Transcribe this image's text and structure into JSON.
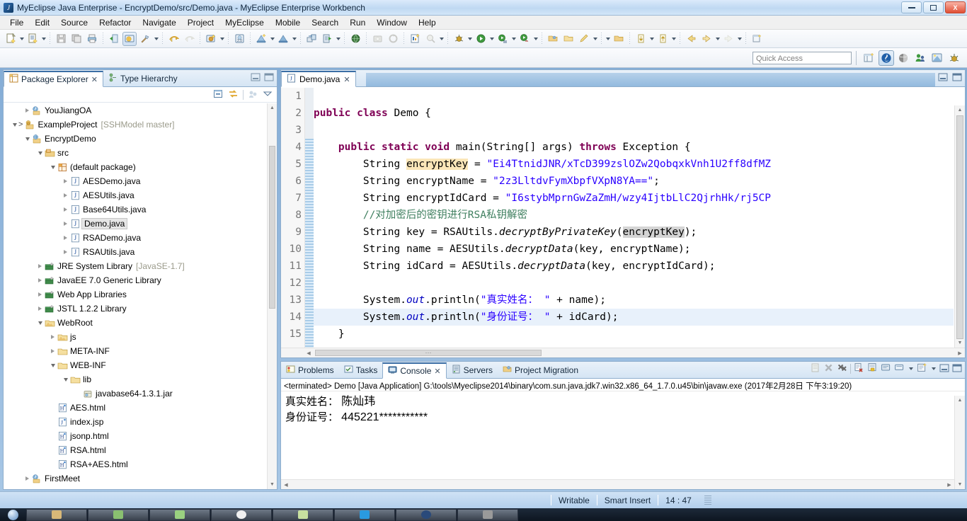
{
  "window": {
    "title": "MyEclipse Java Enterprise - EncryptDemo/src/Demo.java - MyEclipse Enterprise Workbench",
    "logo_glyph": "J",
    "minimize_label": "minimize",
    "restore_label": "restore",
    "close_label": "X"
  },
  "menu": {
    "items": [
      "File",
      "Edit",
      "Source",
      "Refactor",
      "Navigate",
      "Project",
      "MyEclipse",
      "Mobile",
      "Search",
      "Run",
      "Window",
      "Help"
    ]
  },
  "toolbar": {
    "groups": [
      [
        "new-wizard-icon",
        "dropdown",
        "new-java-class-icon",
        "dropdown"
      ],
      [
        "save-icon",
        "save-all-icon",
        "print-icon"
      ],
      [
        "open-browser-icon",
        "web-project-icon",
        "build-hammer-icon",
        "dropdown"
      ],
      [
        "publish-icon",
        "publish-disabled-icon"
      ],
      [
        "deploy-icon",
        "dropdown"
      ],
      [
        "html20-icon"
      ],
      [
        "db-browser-icon",
        "dropdown",
        "db-explorer-icon",
        "dropdown"
      ],
      [
        "remote-sync-icon",
        "run-server-icon",
        "dropdown"
      ],
      [
        "globe-icon"
      ],
      [
        "snapshot-icon",
        "refresh-disabled-icon"
      ],
      [
        "new-report-icon",
        "search-disabled-icon",
        "dropdown"
      ],
      [
        "debug-icon",
        "dropdown"
      ],
      [
        "run-icon",
        "dropdown"
      ],
      [
        "run-config-icon",
        "dropdown"
      ],
      [
        "run-ant-icon",
        "dropdown"
      ],
      [
        "open-type-icon",
        "open-resource-icon",
        "edit-icon",
        "dropdown"
      ],
      [
        "dropdown",
        "folder-icon"
      ],
      [
        "next-annotation-icon",
        "dropdown",
        "prev-annotation-icon",
        "dropdown"
      ],
      [
        "back-icon",
        "forward-icon",
        "dropdown",
        "forward-disabled-icon",
        "dropdown"
      ],
      [
        "new-window-icon"
      ]
    ]
  },
  "quick_access": {
    "placeholder": "Quick Access",
    "value": "",
    "perspective_buttons": [
      "open-perspective-icon",
      "java-perspective-icon",
      "myeclipse-perspective-icon",
      "team-perspective-icon",
      "web-perspective-icon",
      "debug-perspective-icon"
    ]
  },
  "left_view": {
    "tabs": [
      {
        "label": "Package Explorer",
        "icon": "package-explorer-icon",
        "active": true,
        "closable": true
      },
      {
        "label": "Type Hierarchy",
        "icon": "type-hierarchy-icon",
        "active": false,
        "closable": false
      }
    ],
    "tab_controls": [
      "minimize-icon",
      "maximize-icon"
    ],
    "view_toolbar": [
      "collapse-all-icon",
      "link-with-editor-icon",
      "focus-on-active-task-icon",
      "view-menu-icon"
    ],
    "tree": [
      {
        "label": "YouJiangOA",
        "indent": 1,
        "twisty": "collapsed",
        "icon": "java-project-icon",
        "sub": ""
      },
      {
        "label": "ExampleProject",
        "indent": 0,
        "twisty": "expanded",
        "icon": "git-project-icon",
        "sub": "[SSHModel master]",
        "prefix": ">"
      },
      {
        "label": "EncryptDemo",
        "indent": 1,
        "twisty": "expanded",
        "icon": "web-project-icon",
        "sub": ""
      },
      {
        "label": "src",
        "indent": 2,
        "twisty": "expanded",
        "icon": "source-folder-icon",
        "sub": ""
      },
      {
        "label": "(default package)",
        "indent": 3,
        "twisty": "expanded",
        "icon": "package-icon",
        "sub": ""
      },
      {
        "label": "AESDemo.java",
        "indent": 4,
        "twisty": "collapsed",
        "icon": "java-file-icon",
        "sub": ""
      },
      {
        "label": "AESUtils.java",
        "indent": 4,
        "twisty": "collapsed",
        "icon": "java-file-icon",
        "sub": ""
      },
      {
        "label": "Base64Utils.java",
        "indent": 4,
        "twisty": "collapsed",
        "icon": "java-file-icon",
        "sub": ""
      },
      {
        "label": "Demo.java",
        "indent": 4,
        "twisty": "collapsed",
        "icon": "java-file-icon",
        "sub": "",
        "selected": true
      },
      {
        "label": "RSADemo.java",
        "indent": 4,
        "twisty": "collapsed",
        "icon": "java-file-icon",
        "sub": ""
      },
      {
        "label": "RSAUtils.java",
        "indent": 4,
        "twisty": "collapsed",
        "icon": "java-file-icon",
        "sub": ""
      },
      {
        "label": "JRE System Library",
        "indent": 2,
        "twisty": "collapsed",
        "icon": "library-icon",
        "sub": "[JavaSE-1.7]"
      },
      {
        "label": "JavaEE 7.0 Generic Library",
        "indent": 2,
        "twisty": "collapsed",
        "icon": "library-icon",
        "sub": ""
      },
      {
        "label": "Web App Libraries",
        "indent": 2,
        "twisty": "collapsed",
        "icon": "library-icon",
        "sub": ""
      },
      {
        "label": "JSTL 1.2.2 Library",
        "indent": 2,
        "twisty": "collapsed",
        "icon": "library-icon",
        "sub": ""
      },
      {
        "label": "WebRoot",
        "indent": 2,
        "twisty": "expanded",
        "icon": "webroot-folder-icon",
        "sub": ""
      },
      {
        "label": "js",
        "indent": 3,
        "twisty": "collapsed",
        "icon": "webroot-folder-icon",
        "sub": ""
      },
      {
        "label": "META-INF",
        "indent": 3,
        "twisty": "collapsed",
        "icon": "folder-icon",
        "sub": ""
      },
      {
        "label": "WEB-INF",
        "indent": 3,
        "twisty": "expanded",
        "icon": "folder-icon",
        "sub": ""
      },
      {
        "label": "lib",
        "indent": 4,
        "twisty": "expanded",
        "icon": "folder-icon",
        "sub": ""
      },
      {
        "label": "javabase64-1.3.1.jar",
        "indent": 5,
        "twisty": "none",
        "icon": "jar-icon",
        "sub": ""
      },
      {
        "label": "AES.html",
        "indent": 3,
        "twisty": "none",
        "icon": "html-file-icon",
        "sub": ""
      },
      {
        "label": "index.jsp",
        "indent": 3,
        "twisty": "none",
        "icon": "jsp-file-icon",
        "sub": ""
      },
      {
        "label": "jsonp.html",
        "indent": 3,
        "twisty": "none",
        "icon": "html-file-icon",
        "sub": ""
      },
      {
        "label": "RSA.html",
        "indent": 3,
        "twisty": "none",
        "icon": "html-file-icon",
        "sub": ""
      },
      {
        "label": "RSA+AES.html",
        "indent": 3,
        "twisty": "none",
        "icon": "html-file-icon",
        "sub": ""
      },
      {
        "label": "FirstMeet",
        "indent": 1,
        "twisty": "collapsed",
        "icon": "java-project-icon",
        "sub": ""
      }
    ]
  },
  "editor": {
    "tab": {
      "label": "Demo.java",
      "icon": "java-file-icon",
      "closable": true,
      "close_label": "✕"
    },
    "tab_controls": [
      "minimize-icon",
      "maximize-icon"
    ],
    "first_line": 1,
    "current_line": 14,
    "hscroll_grip": "⋯",
    "lines": [
      {
        "n": 1,
        "tokens": []
      },
      {
        "n": 2,
        "tokens": [
          {
            "t": "public",
            "c": "kw"
          },
          {
            "t": " ",
            "c": ""
          },
          {
            "t": "class",
            "c": "kw"
          },
          {
            "t": " Demo {",
            "c": ""
          }
        ]
      },
      {
        "n": 3,
        "tokens": []
      },
      {
        "n": 4,
        "tokens": [
          {
            "t": "    ",
            "c": ""
          },
          {
            "t": "public",
            "c": "kw"
          },
          {
            "t": " ",
            "c": ""
          },
          {
            "t": "static",
            "c": "kw"
          },
          {
            "t": " ",
            "c": ""
          },
          {
            "t": "void",
            "c": "kw"
          },
          {
            "t": " main(String[] args) ",
            "c": ""
          },
          {
            "t": "throws",
            "c": "kw"
          },
          {
            "t": " Exception {",
            "c": ""
          }
        ]
      },
      {
        "n": 5,
        "tokens": [
          {
            "t": "        String ",
            "c": ""
          },
          {
            "t": "encryptKey",
            "c": "hl-wr"
          },
          {
            "t": " = ",
            "c": ""
          },
          {
            "t": "\"Ei4TtnidJNR/xTcD399zslOZw2QobqxkVnh1U2ff8dfMZ",
            "c": "str"
          }
        ]
      },
      {
        "n": 6,
        "tokens": [
          {
            "t": "        String encryptName = ",
            "c": ""
          },
          {
            "t": "\"2z3LltdvFymXbpfVXpN8YA==\"",
            "c": "str"
          },
          {
            "t": ";",
            "c": ""
          }
        ]
      },
      {
        "n": 7,
        "tokens": [
          {
            "t": "        String encryptIdCard = ",
            "c": ""
          },
          {
            "t": "\"I6stybMprnGwZaZmH/wzy4IjtbLlC2QjrhHk/rj5CP",
            "c": "str"
          }
        ]
      },
      {
        "n": 8,
        "tokens": [
          {
            "t": "        //对加密后的密钥进行RSA私钥解密",
            "c": "cmt"
          }
        ]
      },
      {
        "n": 9,
        "tokens": [
          {
            "t": "        String key = RSAUtils.",
            "c": ""
          },
          {
            "t": "decryptByPrivateKey",
            "c": "stat"
          },
          {
            "t": "(",
            "c": ""
          },
          {
            "t": "encryptKey",
            "c": "hl-rd"
          },
          {
            "t": ");",
            "c": ""
          }
        ]
      },
      {
        "n": 10,
        "tokens": [
          {
            "t": "        String name = AESUtils.",
            "c": ""
          },
          {
            "t": "decryptData",
            "c": "stat"
          },
          {
            "t": "(key, encryptName);",
            "c": ""
          }
        ]
      },
      {
        "n": 11,
        "tokens": [
          {
            "t": "        String idCard = AESUtils.",
            "c": ""
          },
          {
            "t": "decryptData",
            "c": "stat"
          },
          {
            "t": "(key, encryptIdCard);",
            "c": ""
          }
        ]
      },
      {
        "n": 12,
        "tokens": []
      },
      {
        "n": 13,
        "tokens": [
          {
            "t": "        System.",
            "c": ""
          },
          {
            "t": "out",
            "c": "fld stat"
          },
          {
            "t": ".println(",
            "c": ""
          },
          {
            "t": "\"真实姓名： \"",
            "c": "str"
          },
          {
            "t": " + name);",
            "c": ""
          }
        ]
      },
      {
        "n": 14,
        "tokens": [
          {
            "t": "        System.",
            "c": ""
          },
          {
            "t": "out",
            "c": "fld stat"
          },
          {
            "t": ".println(",
            "c": ""
          },
          {
            "t": "\"身份证号： \"",
            "c": "str"
          },
          {
            "t": " + idCard);",
            "c": ""
          }
        ],
        "current": true
      },
      {
        "n": 15,
        "tokens": [
          {
            "t": "    }",
            "c": ""
          }
        ]
      }
    ]
  },
  "console": {
    "tabs": [
      {
        "label": "Problems",
        "icon": "problems-icon",
        "active": false,
        "closable": false
      },
      {
        "label": "Tasks",
        "icon": "tasks-icon",
        "active": false,
        "closable": false
      },
      {
        "label": "Console",
        "icon": "console-icon",
        "active": true,
        "closable": true,
        "close_label": "✕"
      },
      {
        "label": "Servers",
        "icon": "servers-icon",
        "active": false,
        "closable": false
      },
      {
        "label": "Project Migration",
        "icon": "project-migration-icon",
        "active": false,
        "closable": false
      }
    ],
    "tab_controls": [
      "clear-console-icon",
      "terminate-icon",
      "remove-all-terminated-icon",
      "remove-launch-icon",
      "scroll-lock-icon",
      "show-console-icon",
      "pin-console-icon",
      "display-selected-console-icon",
      "open-console-icon",
      "minimize-icon",
      "maximize-icon"
    ],
    "terminated_line": "<terminated> Demo [Java Application] G:\\tools\\Myeclipse2014\\binary\\com.sun.java.jdk7.win32.x86_64_1.7.0.u45\\bin\\javaw.exe (2017年2月28日 下午3:19:20)",
    "output": [
      {
        "label": "真实姓名：",
        "value": "陈灿玮"
      },
      {
        "label": "身份证号：",
        "value": "445221***********"
      }
    ]
  },
  "statusbar": {
    "writable": "Writable",
    "insert_mode": "Smart Insert",
    "cursor_position": "14 : 47"
  },
  "taskbar": {
    "items": [
      "browser",
      "explorer",
      "notepad",
      "mail",
      "chrome",
      "player",
      "eclipse",
      "terminal",
      "misc"
    ]
  },
  "colors": {
    "accent": "#3b6ea5",
    "keyword": "#7f0055",
    "string": "#2a00ff",
    "comment": "#3f7f5f",
    "field": "#0000c0",
    "write_occurrence": "#fbe6b8",
    "read_occurrence": "#d4d4d4",
    "current_line": "#e8f1fb",
    "titlebar": "#bfd9f2"
  }
}
